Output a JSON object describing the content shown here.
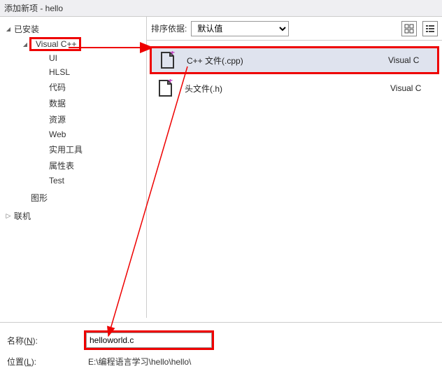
{
  "window": {
    "title": "添加新项 - hello"
  },
  "sidebar": {
    "installed": "已安装",
    "visual_cpp": "Visual C++",
    "items": [
      "UI",
      "HLSL",
      "代码",
      "数据",
      "资源",
      "Web",
      "实用工具",
      "属性表",
      "Test"
    ],
    "graphics": "图形",
    "online": "联机"
  },
  "toolbar": {
    "sort_label": "排序依据:",
    "sort_value": "默认值"
  },
  "templates": [
    {
      "name": "C++ 文件(.cpp)",
      "lang": "Visual C",
      "selected": true
    },
    {
      "name": "头文件(.h)",
      "lang": "Visual C",
      "selected": false
    }
  ],
  "form": {
    "name_label": "名称(N):",
    "name_underline": "N",
    "name_value": "helloworld.c",
    "location_label": "位置(L):",
    "location_underline": "L",
    "location_value": "E:\\编程语言学习\\hello\\hello\\"
  }
}
